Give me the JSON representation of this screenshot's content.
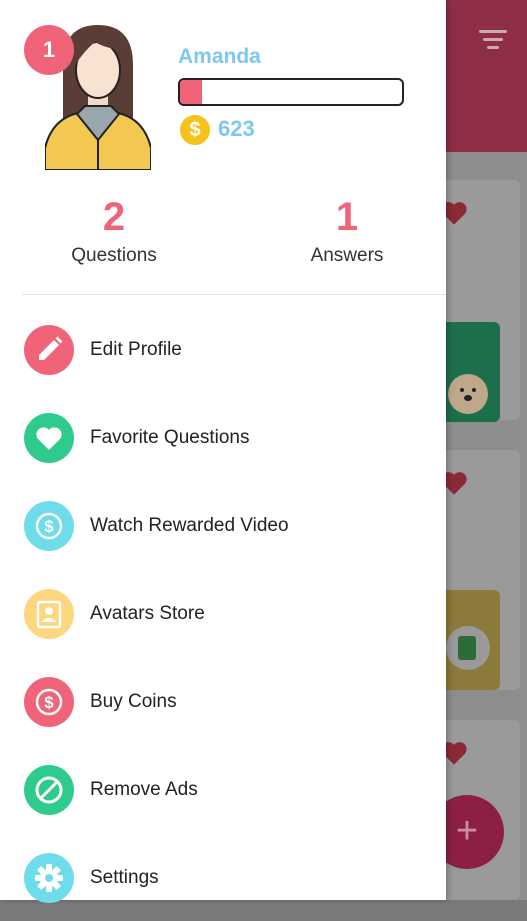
{
  "user": {
    "name": "Amanda",
    "level": "1",
    "xp_progress": 0.1,
    "coins": "623"
  },
  "stats": {
    "questions": {
      "value": "2",
      "label": "Questions"
    },
    "answers": {
      "value": "1",
      "label": "Answers"
    }
  },
  "menu": {
    "items": [
      {
        "label": "Edit Profile",
        "icon": "pencil-icon",
        "color": "#f0647a"
      },
      {
        "label": "Favorite Questions",
        "icon": "heart-icon",
        "color": "#2ecb8c"
      },
      {
        "label": "Watch Rewarded Video",
        "icon": "dollar-coin-icon",
        "color": "#6fdcec"
      },
      {
        "label": "Avatars Store",
        "icon": "contact-card-icon",
        "color": "#fcd77f"
      },
      {
        "label": "Buy Coins",
        "icon": "dollar-coin-icon",
        "color": "#f0647a"
      },
      {
        "label": "Remove Ads",
        "icon": "block-icon",
        "color": "#2ecb8c"
      },
      {
        "label": "Settings",
        "icon": "gear-icon",
        "color": "#6fdcec"
      }
    ]
  },
  "background": {
    "fab_label": "+"
  }
}
